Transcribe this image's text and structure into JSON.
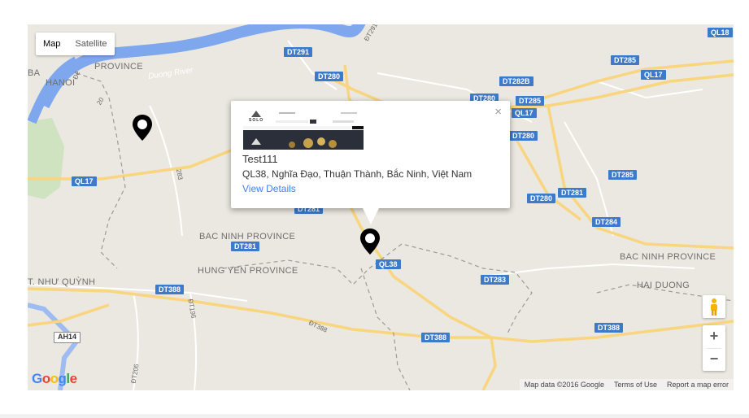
{
  "map_type": {
    "map": "Map",
    "satellite": "Satellite",
    "selected": "Map"
  },
  "shields": [
    {
      "id": "ql18",
      "label": "QL18"
    },
    {
      "id": "dt291",
      "label": "DT291"
    },
    {
      "id": "dt285a",
      "label": "DT285"
    },
    {
      "id": "ql17a",
      "label": "QL17"
    },
    {
      "id": "dt280a",
      "label": "DT280"
    },
    {
      "id": "dt282b",
      "label": "DT282B"
    },
    {
      "id": "dt280b",
      "label": "DT280"
    },
    {
      "id": "dt285b",
      "label": "DT285"
    },
    {
      "id": "ql17b",
      "label": "QL17"
    },
    {
      "id": "dt280c",
      "label": "DT280"
    },
    {
      "id": "dt285c",
      "label": "DT285"
    },
    {
      "id": "ql17c",
      "label": "QL17"
    },
    {
      "id": "dt280d",
      "label": "DT280"
    },
    {
      "id": "dt281a",
      "label": "DT281"
    },
    {
      "id": "dt284",
      "label": "DT284"
    },
    {
      "id": "dt281b",
      "label": "DT281"
    },
    {
      "id": "dt281c",
      "label": "DT281"
    },
    {
      "id": "ql38",
      "label": "QL38"
    },
    {
      "id": "dt283",
      "label": "DT283"
    },
    {
      "id": "dt388a",
      "label": "DT388"
    },
    {
      "id": "dt388b",
      "label": "DT388"
    },
    {
      "id": "dt388c",
      "label": "DT388"
    },
    {
      "id": "ah14",
      "label": "AH14"
    }
  ],
  "places": {
    "hanoi": "HANOI",
    "ba_province": "BA",
    "province_top": "PROVINCE",
    "bac_ninh_1": "BAC NINH PROVINCE",
    "hung_yen": "HUNG YEN PROVINCE",
    "bac_ninh_2": "BAC NINH PROVINCE",
    "hai_duong": "HAI DUONG",
    "nhu_quynh": "T. NHƯ QUỲNH",
    "duong_river": "Duong River"
  },
  "road_labels": {
    "r283": "283",
    "r20": "20",
    "dt196": "ĐT196",
    "dt206": "ĐT206",
    "dt388_diag": "ĐT388",
    "dt291_diag": "ĐT291",
    "de": "Đê"
  },
  "info_window": {
    "title": "Test111",
    "address": "QL38, Nghĩa Đạo, Thuận Thành, Bắc Ninh, Việt Nam",
    "link": "View Details",
    "close": "×",
    "thumb_brand": "SOLO"
  },
  "controls": {
    "zoom_in": "+",
    "zoom_out": "−"
  },
  "footer": {
    "map_data": "Map data ©2016 Google",
    "terms": "Terms of Use",
    "report": "Report a map error"
  },
  "logo": "Google",
  "colors": {
    "land": "#ebe8e1",
    "river": "#7fa7ee",
    "road_major": "#f8d57e",
    "shield": "#3d7ac9",
    "link": "#427fed"
  }
}
